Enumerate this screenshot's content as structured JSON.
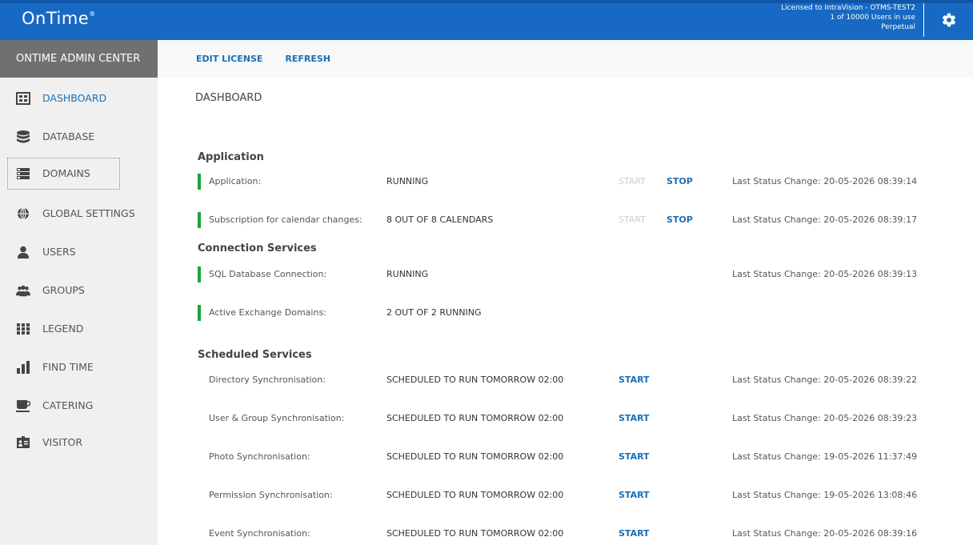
{
  "header": {
    "logo": "OnTime",
    "logo_mark": "®",
    "license_line1": "Licensed to IntraVision - OTMS-TEST2",
    "license_line2": "1 of 10000 Users in use",
    "license_line3": "Perpetual",
    "settings_icon": "gear-icon"
  },
  "admin_center": {
    "title": "ONTIME ADMIN CENTER"
  },
  "toolbar": {
    "edit_license": "EDIT LICENSE",
    "refresh": "REFRESH"
  },
  "sidebar": {
    "items": [
      {
        "label": "DASHBOARD",
        "icon": "dashboard-icon",
        "active": true
      },
      {
        "label": "DATABASE",
        "icon": "database-icon"
      },
      {
        "label": "DOMAINS",
        "icon": "domains-icon"
      },
      {
        "label": "GLOBAL SETTINGS",
        "icon": "globe-icon"
      },
      {
        "label": "USERS",
        "icon": "user-icon"
      },
      {
        "label": "GROUPS",
        "icon": "groups-icon"
      },
      {
        "label": "LEGEND",
        "icon": "legend-icon"
      },
      {
        "label": "FIND TIME",
        "icon": "bar-chart-icon"
      },
      {
        "label": "CATERING",
        "icon": "cup-icon"
      },
      {
        "label": "VISITOR",
        "icon": "visitor-badge-icon"
      }
    ]
  },
  "main": {
    "title": "DASHBOARD",
    "sections": {
      "application": "Application",
      "connection": "Connection Services",
      "scheduled": "Scheduled Services"
    },
    "rows": [
      {
        "name": "Application:",
        "status": "RUNNING",
        "start": "START",
        "stop": "STOP",
        "change": "Last Status Change: 20-05-2026 08:39:14"
      },
      {
        "name": "Subscription for calendar changes:",
        "status": "8 OUT OF 8 CALENDARS",
        "start": "START",
        "stop": "STOP",
        "change": "Last Status Change: 20-05-2026 08:39:17"
      },
      {
        "name": "SQL Database Connection:",
        "status": "RUNNING",
        "change": "Last Status Change: 20-05-2026 08:39:13"
      },
      {
        "name": "Active Exchange Domains:",
        "status": "2 OUT OF 2 RUNNING"
      },
      {
        "name": "Directory Synchronisation:",
        "status": "SCHEDULED TO RUN TOMORROW 02:00",
        "start": "START",
        "change": "Last Status Change: 20-05-2026 08:39:22"
      },
      {
        "name": "User & Group Synchronisation:",
        "status": "SCHEDULED TO RUN TOMORROW 02:00",
        "start": "START",
        "change": "Last Status Change: 20-05-2026 08:39:23"
      },
      {
        "name": "Photo Synchronisation:",
        "status": "SCHEDULED TO RUN TOMORROW 02:00",
        "start": "START",
        "change": "Last Status Change: 19-05-2026 11:37:49"
      },
      {
        "name": "Permission Synchronisation:",
        "status": "SCHEDULED TO RUN TOMORROW 02:00",
        "start": "START",
        "change": "Last Status Change: 19-05-2026 13:08:46"
      },
      {
        "name": "Event Synchronisation:",
        "status": "SCHEDULED TO RUN TOMORROW 02:00",
        "start": "START",
        "change": "Last Status Change: 20-05-2026 08:39:16"
      }
    ]
  },
  "colors": {
    "brand": "#1769c4",
    "link": "#1a6fb5",
    "running": "#1fa23a",
    "disabled": "#cfcfcf"
  }
}
